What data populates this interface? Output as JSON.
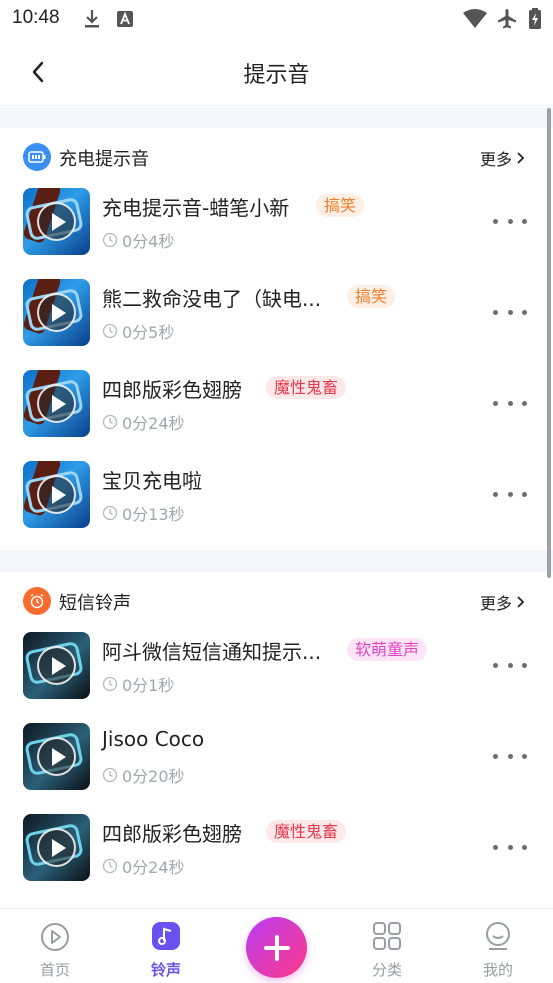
{
  "status_bar": {
    "time": "10:48"
  },
  "nav": {
    "title": "提示音"
  },
  "colors": {
    "accent": "#6a52f0",
    "fab_start": "#b83cf3",
    "fab_end": "#ff3a88",
    "tag_orange": "#ef7d2b",
    "tag_red": "#e6394a",
    "tag_pink": "#e144c3"
  },
  "sections": [
    {
      "title": "充电提示音",
      "icon": "battery-icon",
      "more_label": "更多",
      "items": [
        {
          "title": "充电提示音-蜡笔小新",
          "tag": "搞笑",
          "duration": "0分4秒"
        },
        {
          "title": "熊二救命没电了（缺电...",
          "tag": "搞笑",
          "duration": "0分5秒"
        },
        {
          "title": "四郎版彩色翅膀",
          "tag": "魔性鬼畜",
          "duration": "0分24秒"
        },
        {
          "title": "宝贝充电啦",
          "tag": "",
          "duration": "0分13秒"
        }
      ]
    },
    {
      "title": "短信铃声",
      "icon": "alarm-clock-icon",
      "more_label": "更多",
      "items": [
        {
          "title": "阿斗微信短信通知提示...",
          "tag": "软萌童声",
          "duration": "0分1秒"
        },
        {
          "title": "Jisoo Coco",
          "tag": "",
          "duration": "0分20秒"
        },
        {
          "title": "四郎版彩色翅膀",
          "tag": "魔性鬼畜",
          "duration": "0分24秒"
        }
      ]
    }
  ],
  "tabs": [
    {
      "label": "首页",
      "icon": "home-play-icon",
      "active": false
    },
    {
      "label": "铃声",
      "icon": "music-note-icon",
      "active": true
    },
    {
      "label": "分类",
      "icon": "grid-icon",
      "active": false
    },
    {
      "label": "我的",
      "icon": "profile-icon",
      "active": false
    }
  ],
  "fab": {
    "icon": "plus-icon"
  }
}
